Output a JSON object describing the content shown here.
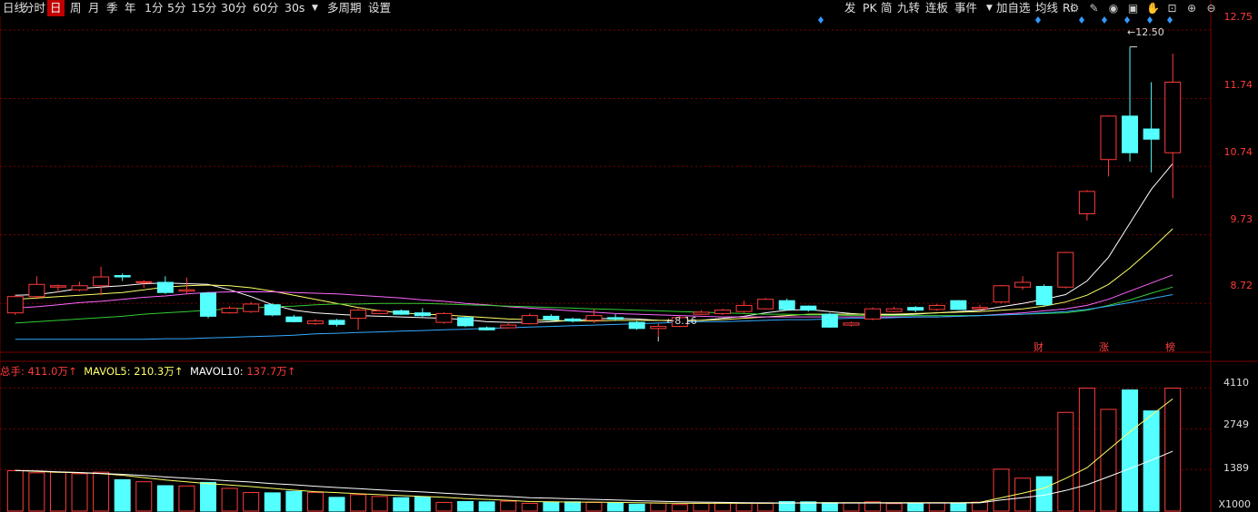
{
  "toolbar": {
    "left": [
      "日线",
      "分时",
      "日",
      "周",
      "月",
      "季",
      "年",
      "1分",
      "5分",
      "15分",
      "30分",
      "60分",
      "30s",
      "多周期",
      "设置"
    ],
    "active": "日",
    "right": [
      "发",
      "PK",
      "简",
      "九转",
      "连板",
      "事件",
      "加自选",
      "均线",
      "Ri"
    ]
  },
  "icons": [
    "settings-icon",
    "pen-icon",
    "eye-icon",
    "lock-icon",
    "hand-icon",
    "lock-open-icon",
    "zoom-in-icon",
    "zoom-out-icon"
  ],
  "colors": {
    "up": "#ff3b3b",
    "down": "#54ffff",
    "ma5": "#ffffff",
    "ma10": "#ffff66",
    "ma20": "#ff66ff",
    "ma30": "#33cc33",
    "ma60": "#33aaff",
    "grid": "#7a0000"
  },
  "price_axis": [
    "12.75",
    "11.74",
    "10.74",
    "9.73",
    "8.72"
  ],
  "volume_axis": [
    "4110",
    "2749",
    "1389",
    "X1000"
  ],
  "annotations": {
    "high": "12.50",
    "low": "8.16"
  },
  "event_markers": [
    "财",
    "涨",
    "榜"
  ],
  "volume_legend": {
    "total_label": "总手:",
    "total_value": "411.0万↑",
    "mavol5_label": "MAVOL5:",
    "mavol5_value": "210.3万↑",
    "mavol10_label": "MAVOL10:",
    "mavol10_value": "137.7万↑"
  },
  "chart_data": [
    {
      "type": "candlestick",
      "ylim": [
        8.0,
        12.95
      ],
      "grid": true,
      "candles": [
        [
          8.58,
          8.82,
          8.55,
          8.85
        ],
        [
          8.82,
          9.0,
          8.78,
          9.12
        ],
        [
          8.96,
          8.98,
          8.88,
          9.0
        ],
        [
          8.92,
          8.98,
          8.9,
          9.04
        ],
        [
          8.98,
          9.11,
          8.84,
          9.26
        ],
        [
          9.13,
          9.11,
          9.05,
          9.16
        ],
        [
          9.03,
          9.04,
          8.95,
          9.06
        ],
        [
          9.03,
          8.88,
          8.86,
          9.12
        ],
        [
          8.9,
          8.92,
          8.85,
          9.1
        ],
        [
          8.87,
          8.53,
          8.5,
          8.89
        ],
        [
          8.58,
          8.65,
          8.57,
          8.68
        ],
        [
          8.6,
          8.71,
          8.58,
          8.74
        ],
        [
          8.7,
          8.55,
          8.53,
          8.72
        ],
        [
          8.52,
          8.45,
          8.44,
          8.55
        ],
        [
          8.42,
          8.46,
          8.4,
          8.49
        ],
        [
          8.47,
          8.41,
          8.38,
          8.49
        ],
        [
          8.5,
          8.62,
          8.33,
          8.66
        ],
        [
          8.57,
          8.61,
          8.56,
          8.63
        ],
        [
          8.61,
          8.56,
          8.55,
          8.63
        ],
        [
          8.58,
          8.54,
          8.52,
          8.65
        ],
        [
          8.44,
          8.57,
          8.42,
          8.59
        ],
        [
          8.51,
          8.39,
          8.37,
          8.53
        ],
        [
          8.36,
          8.33,
          8.32,
          8.38
        ],
        [
          8.36,
          8.4,
          8.35,
          8.44
        ],
        [
          8.42,
          8.54,
          8.41,
          8.57
        ],
        [
          8.53,
          8.48,
          8.46,
          8.56
        ],
        [
          8.49,
          8.46,
          8.44,
          8.51
        ],
        [
          8.47,
          8.54,
          8.43,
          8.64
        ],
        [
          8.51,
          8.49,
          8.46,
          8.56
        ],
        [
          8.44,
          8.35,
          8.33,
          8.46
        ],
        [
          8.35,
          8.38,
          8.23,
          8.42
        ],
        [
          8.38,
          8.51,
          8.37,
          8.54
        ],
        [
          8.56,
          8.59,
          8.55,
          8.62
        ],
        [
          8.57,
          8.62,
          8.55,
          8.64
        ],
        [
          8.6,
          8.69,
          8.58,
          8.76
        ],
        [
          8.64,
          8.78,
          8.63,
          8.8
        ],
        [
          8.76,
          8.63,
          8.62,
          8.79
        ],
        [
          8.68,
          8.62,
          8.6,
          8.69
        ],
        [
          8.56,
          8.37,
          8.36,
          8.58
        ],
        [
          8.4,
          8.43,
          8.38,
          8.45
        ],
        [
          8.49,
          8.64,
          8.47,
          8.66
        ],
        [
          8.6,
          8.64,
          8.59,
          8.67
        ],
        [
          8.66,
          8.62,
          8.59,
          8.68
        ],
        [
          8.63,
          8.69,
          8.61,
          8.71
        ],
        [
          8.76,
          8.63,
          8.62,
          8.77
        ],
        [
          8.64,
          8.66,
          8.62,
          8.7
        ],
        [
          8.74,
          8.98,
          8.72,
          8.99
        ],
        [
          8.96,
          9.03,
          8.92,
          9.12
        ],
        [
          8.97,
          8.7,
          8.68,
          9.0
        ],
        [
          8.96,
          9.47,
          8.94,
          9.48
        ],
        [
          10.04,
          10.37,
          9.94,
          10.39
        ],
        [
          10.84,
          11.48,
          10.59,
          11.49
        ],
        [
          11.48,
          10.94,
          10.81,
          12.5
        ],
        [
          11.29,
          11.14,
          10.65,
          11.98
        ],
        [
          10.94,
          11.98,
          10.27,
          12.4
        ]
      ],
      "ma": {
        "MA5": [
          8.84,
          8.85,
          8.89,
          8.94,
          8.96,
          8.98,
          9.01,
          9.02,
          9.01,
          9.0,
          8.92,
          8.82,
          8.7,
          8.62,
          8.58,
          8.56,
          8.54,
          8.53,
          8.52,
          8.51,
          8.5,
          8.48,
          8.45,
          8.44,
          8.44,
          8.45,
          8.47,
          8.49,
          8.5,
          8.49,
          8.47,
          8.46,
          8.47,
          8.5,
          8.53,
          8.58,
          8.62,
          8.63,
          8.6,
          8.57,
          8.55,
          8.55,
          8.56,
          8.58,
          8.6,
          8.62,
          8.67,
          8.72,
          8.78,
          8.85,
          9.05,
          9.4,
          9.9,
          10.4,
          10.78
        ],
        "MA10": [
          8.78,
          8.8,
          8.82,
          8.84,
          8.86,
          8.88,
          8.92,
          8.96,
          8.98,
          8.99,
          8.98,
          8.95,
          8.9,
          8.84,
          8.78,
          8.72,
          8.66,
          8.61,
          8.58,
          8.56,
          8.55,
          8.53,
          8.51,
          8.49,
          8.48,
          8.47,
          8.46,
          8.46,
          8.47,
          8.47,
          8.47,
          8.47,
          8.47,
          8.48,
          8.5,
          8.52,
          8.54,
          8.56,
          8.56,
          8.56,
          8.56,
          8.56,
          8.57,
          8.58,
          8.59,
          8.6,
          8.62,
          8.64,
          8.68,
          8.74,
          8.84,
          9.0,
          9.24,
          9.52,
          9.82
        ],
        "MA20": [
          8.65,
          8.67,
          8.7,
          8.73,
          8.75,
          8.78,
          8.81,
          8.83,
          8.86,
          8.88,
          8.89,
          8.89,
          8.89,
          8.88,
          8.87,
          8.86,
          8.84,
          8.82,
          8.8,
          8.77,
          8.75,
          8.72,
          8.7,
          8.67,
          8.65,
          8.63,
          8.61,
          8.59,
          8.57,
          8.56,
          8.55,
          8.54,
          8.53,
          8.52,
          8.52,
          8.52,
          8.52,
          8.52,
          8.52,
          8.52,
          8.52,
          8.52,
          8.52,
          8.52,
          8.53,
          8.54,
          8.56,
          8.58,
          8.61,
          8.64,
          8.69,
          8.78,
          8.9,
          9.02,
          9.14
        ],
        "MA30": [
          8.43,
          8.45,
          8.47,
          8.49,
          8.51,
          8.53,
          8.56,
          8.58,
          8.6,
          8.62,
          8.64,
          8.65,
          8.67,
          8.68,
          8.7,
          8.71,
          8.71,
          8.72,
          8.72,
          8.72,
          8.71,
          8.7,
          8.69,
          8.68,
          8.67,
          8.66,
          8.65,
          8.64,
          8.63,
          8.62,
          8.61,
          8.6,
          8.59,
          8.58,
          8.57,
          8.56,
          8.56,
          8.55,
          8.55,
          8.54,
          8.54,
          8.54,
          8.54,
          8.54,
          8.54,
          8.54,
          8.55,
          8.56,
          8.57,
          8.58,
          8.62,
          8.69,
          8.77,
          8.87,
          8.96
        ],
        "MA60": [
          8.19,
          8.19,
          8.19,
          8.19,
          8.19,
          8.19,
          8.19,
          8.2,
          8.2,
          8.21,
          8.22,
          8.23,
          8.24,
          8.25,
          8.27,
          8.28,
          8.29,
          8.3,
          8.31,
          8.32,
          8.33,
          8.34,
          8.35,
          8.36,
          8.37,
          8.38,
          8.39,
          8.4,
          8.41,
          8.42,
          8.43,
          8.44,
          8.45,
          8.45,
          8.46,
          8.47,
          8.48,
          8.48,
          8.49,
          8.5,
          8.5,
          8.51,
          8.52,
          8.52,
          8.53,
          8.54,
          8.55,
          8.56,
          8.58,
          8.6,
          8.63,
          8.68,
          8.73,
          8.79,
          8.85
        ]
      }
    },
    {
      "type": "bar",
      "unit": "X1000",
      "ylim": [
        0,
        4400
      ],
      "volumes": [
        1350,
        1280,
        1300,
        1250,
        1300,
        1050,
        980,
        850,
        840,
        960,
        760,
        620,
        610,
        660,
        620,
        460,
        550,
        490,
        450,
        470,
        290,
        320,
        310,
        330,
        260,
        300,
        310,
        290,
        270,
        230,
        270,
        220,
        260,
        270,
        270,
        260,
        320,
        310,
        280,
        280,
        310,
        250,
        270,
        280,
        250,
        300,
        1400,
        1100,
        1150,
        3300,
        4110,
        3400,
        4050,
        3350,
        4110
      ],
      "mavol5": [
        1360,
        1330,
        1300,
        1280,
        1250,
        1200,
        1120,
        1040,
        980,
        920,
        870,
        820,
        760,
        700,
        650,
        620,
        580,
        550,
        520,
        490,
        460,
        420,
        390,
        360,
        320,
        310,
        300,
        300,
        290,
        280,
        270,
        260,
        260,
        260,
        260,
        260,
        270,
        280,
        280,
        280,
        280,
        280,
        280,
        280,
        280,
        290,
        450,
        600,
        770,
        1090,
        1450,
        2050,
        2650,
        3200,
        3750
      ],
      "mavol10": [
        1360,
        1340,
        1310,
        1290,
        1260,
        1230,
        1190,
        1140,
        1100,
        1060,
        1010,
        970,
        920,
        880,
        830,
        790,
        750,
        710,
        670,
        640,
        600,
        560,
        520,
        490,
        450,
        430,
        410,
        390,
        370,
        350,
        330,
        310,
        300,
        290,
        280,
        275,
        270,
        270,
        270,
        270,
        270,
        270,
        270,
        270,
        270,
        275,
        370,
        450,
        530,
        690,
        880,
        1150,
        1420,
        1700,
        2000
      ]
    }
  ]
}
